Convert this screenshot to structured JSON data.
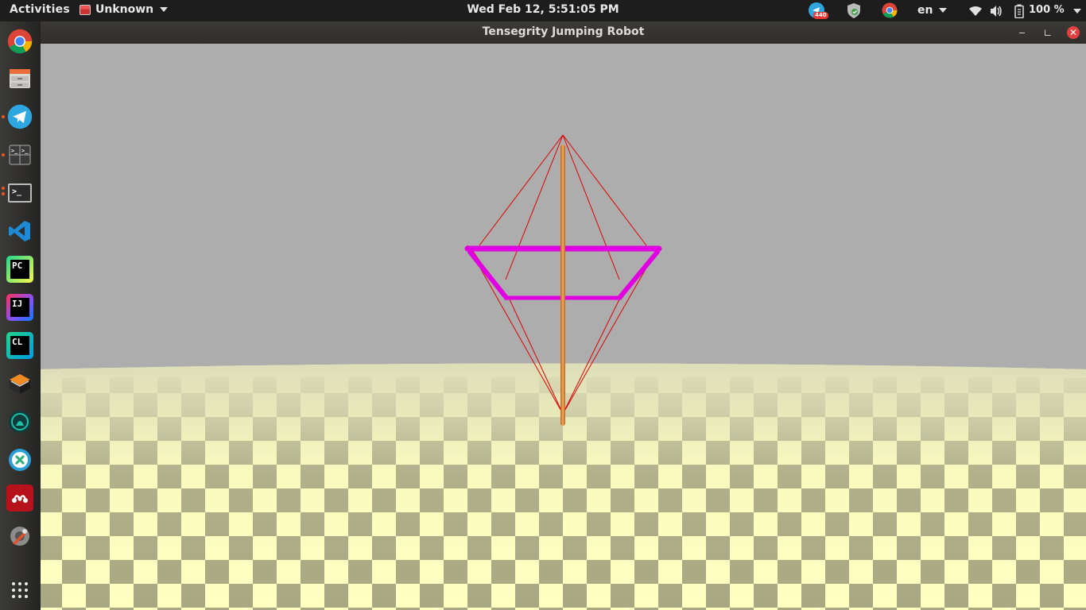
{
  "topbar": {
    "activities": "Activities",
    "app_menu": "Unknown",
    "clock": "Wed Feb 12,  5:51:05 PM",
    "telegram_badge": "440",
    "language": "en",
    "battery": "100 %"
  },
  "window": {
    "title": "Tensegrity Jumping Robot"
  },
  "dock": {
    "items": [
      {
        "name": "chrome",
        "label": ""
      },
      {
        "name": "files",
        "label": ""
      },
      {
        "name": "telegram",
        "label": ""
      },
      {
        "name": "terminator",
        "label": ""
      },
      {
        "name": "terminal",
        "label": ">_"
      },
      {
        "name": "vscode",
        "label": ""
      },
      {
        "name": "pycharm",
        "label": "PC"
      },
      {
        "name": "intellij",
        "label": "IJ"
      },
      {
        "name": "clion",
        "label": "CL"
      },
      {
        "name": "virtualbox",
        "label": ""
      },
      {
        "name": "gitkraken",
        "label": ""
      },
      {
        "name": "zotero",
        "label": ""
      },
      {
        "name": "mendeley",
        "label": ""
      },
      {
        "name": "settings",
        "label": ""
      },
      {
        "name": "app-grid",
        "label": ""
      }
    ]
  },
  "colors": {
    "sky": "#adadad",
    "floor_light": "#ffffc0",
    "floor_dark": "#a8a882",
    "strut_magenta": "#e100e1",
    "rod_orange": "#e08a35",
    "cable_red": "#dd0000"
  }
}
